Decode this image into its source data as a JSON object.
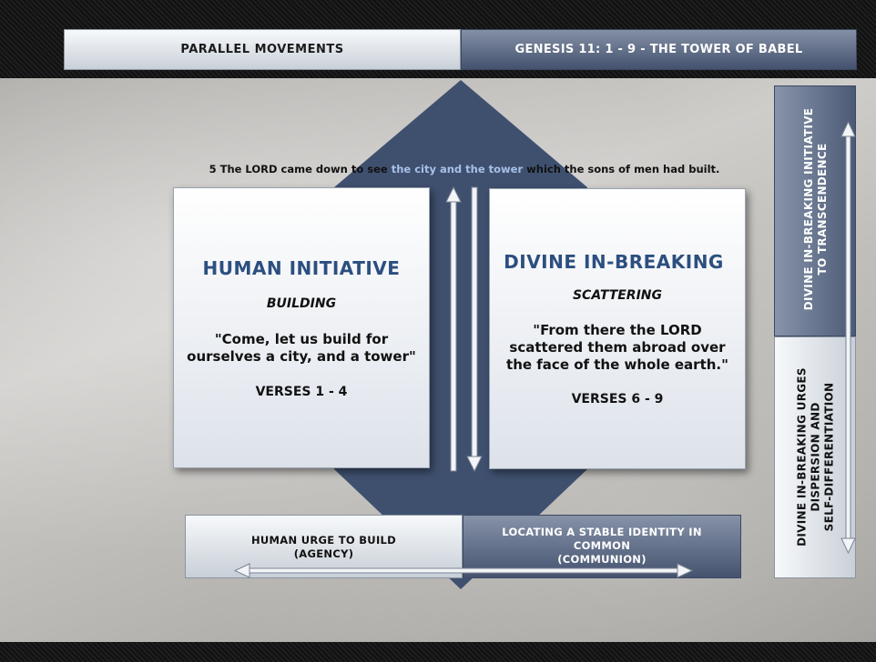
{
  "header": {
    "left_title": "PARALLEL MOVEMENTS",
    "right_title": "GENESIS 11: 1 - 9 - THE TOWER OF BABEL"
  },
  "verse5": {
    "before": "5 The LORD came down to see ",
    "highlight": "the city and the tower",
    "after": " which the sons of men had built."
  },
  "left_card": {
    "title": "HUMAN INITIATIVE",
    "subtitle": "BUILDING",
    "quote_line1": "\"Come, let us build for",
    "quote_line2": "ourselves a city, and a tower\"",
    "verses": "VERSES 1 - 4"
  },
  "right_card": {
    "title": "DIVINE IN-BREAKING",
    "subtitle": "SCATTERING",
    "quote_line1": "\"From there the LORD",
    "quote_line2": "scattered them abroad over",
    "quote_line3": "the face of the whole earth.\"",
    "verses": "VERSES 6 - 9"
  },
  "bottom_left": {
    "line1": "HUMAN URGE TO BUILD",
    "line2": "(AGENCY)"
  },
  "bottom_right": {
    "line1": "LOCATING A STABLE IDENTITY IN",
    "line2": "COMMON",
    "line3": "(COMMUNION)"
  },
  "side_top": {
    "line1": "DIVINE IN-BREAKING INITIATIVE",
    "line2": "TO TRANSCENDENCE"
  },
  "side_bottom": {
    "line1": "DIVINE IN-BREAKING URGES",
    "line2": "DISPERSION AND",
    "line3": "SELF-DIFFERENTIATION"
  },
  "colors": {
    "diamond": "#3f506f",
    "title_blue": "#2c4f80",
    "highlight": "#a8c0e8"
  }
}
